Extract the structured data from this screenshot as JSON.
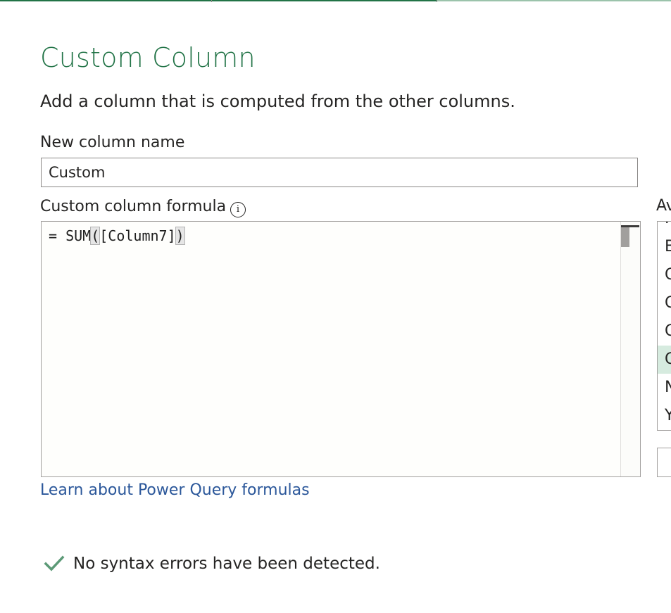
{
  "dialog": {
    "title": "Custom Column",
    "description": "Add a column that is computed from the other columns."
  },
  "new_column": {
    "label": "New column name",
    "value": "Custom"
  },
  "formula": {
    "label": "Custom column formula",
    "prefix": "= SUM",
    "open_paren": "(",
    "argument": "[Column7]",
    "close_paren": ")"
  },
  "learn_link": "Learn about Power Query formulas",
  "status": {
    "text": "No syntax errors have been detected.",
    "color": "#5c9a77"
  },
  "available_columns": {
    "label": "Av",
    "items": [
      "N",
      "B",
      "C",
      "C",
      "C",
      "C",
      "N",
      "Y"
    ],
    "selected_index": 5
  },
  "colors": {
    "accent": "#217346",
    "link": "#2b579a",
    "selected_row": "#d6ebdf"
  }
}
